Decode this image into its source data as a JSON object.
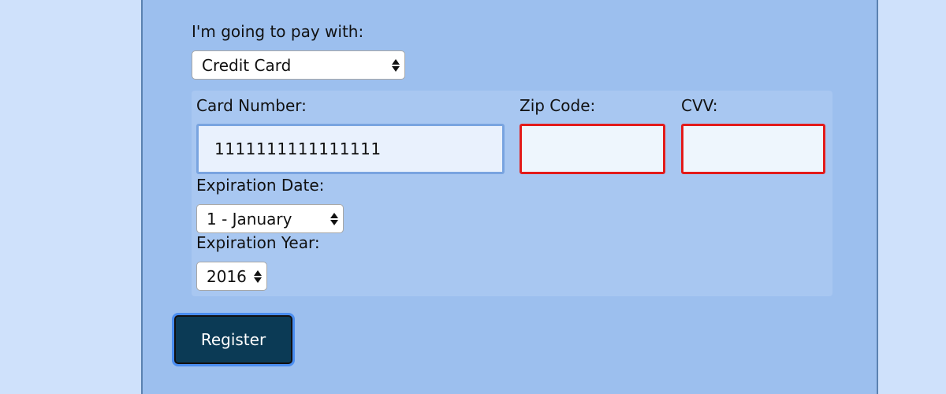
{
  "payment": {
    "label": "I'm going to pay with:",
    "selected": "Credit Card"
  },
  "credit_card": {
    "card_number_label": "Card Number:",
    "card_number_value": "1111111111111111",
    "zip_label": "Zip Code:",
    "zip_value": "",
    "cvv_label": "CVV:",
    "cvv_value": "",
    "exp_date_label": "Expiration Date:",
    "exp_date_selected": "1 - January",
    "exp_year_label": "Expiration Year:",
    "exp_year_selected": "2016"
  },
  "actions": {
    "register_label": "Register"
  },
  "colors": {
    "page_bg": "#cfe1fb",
    "panel_bg": "#9cbfee",
    "cc_box_bg": "#a8c7f1",
    "error_border": "#e31b1b",
    "focus_border": "#79a4e0",
    "button_bg": "#0b3a55",
    "button_focus_ring": "#4a8df0"
  }
}
